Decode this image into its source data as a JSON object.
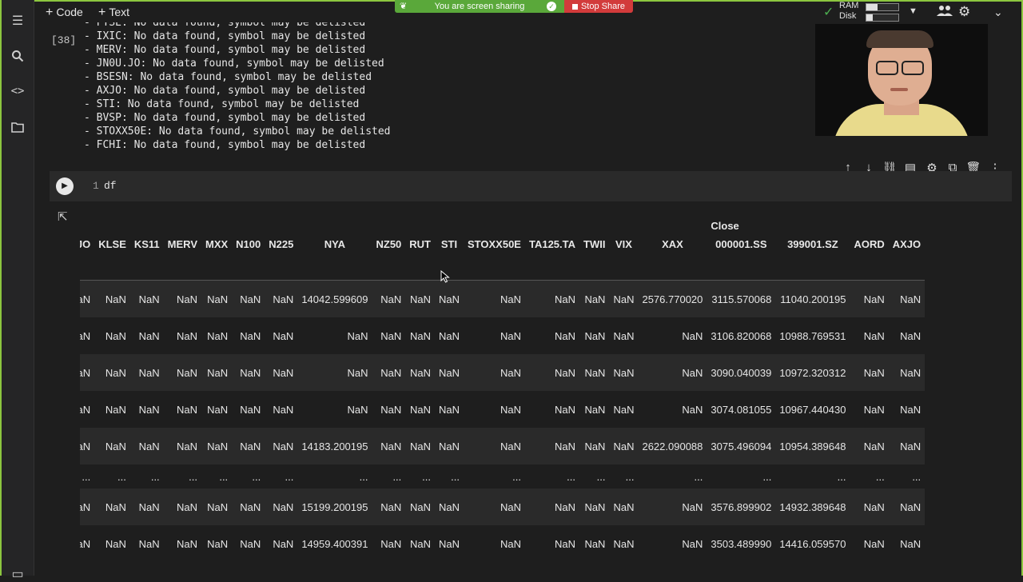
{
  "toolbar": {
    "code_label": "Code",
    "text_label": "Text"
  },
  "share": {
    "message": "You are screen sharing",
    "stop_label": "Stop Share"
  },
  "runtime": {
    "ram_label": "RAM",
    "disk_label": "Disk",
    "ram_usage": 0.35,
    "disk_usage": 0.2
  },
  "output": {
    "execution_count": "[38]",
    "lines": [
      "- FTSE: No data found, symbol may be delisted",
      "- IXIC: No data found, symbol may be delisted",
      "- MERV: No data found, symbol may be delisted",
      "- JN0U.JO: No data found, symbol may be delisted",
      "- BSESN: No data found, symbol may be delisted",
      "- AXJO: No data found, symbol may be delisted",
      "- STI: No data found, symbol may be delisted",
      "- BVSP: No data found, symbol may be delisted",
      "- STOXX50E: No data found, symbol may be delisted",
      "- FCHI: No data found, symbol may be delisted"
    ]
  },
  "cell": {
    "line_number": "1",
    "code": "df"
  },
  "dataframe": {
    "group_header": "Close",
    "columns": [
      "J.JO",
      "KLSE",
      "KS11",
      "MERV",
      "MXX",
      "N100",
      "N225",
      "NYA",
      "NZ50",
      "RUT",
      "STI",
      "STOXX50E",
      "TA125.TA",
      "TWII",
      "VIX",
      "XAX",
      "000001.SS",
      "399001.SZ",
      "AORD",
      "AXJO"
    ],
    "rows": [
      [
        "NaN",
        "NaN",
        "NaN",
        "NaN",
        "NaN",
        "NaN",
        "NaN",
        "14042.599609",
        "NaN",
        "NaN",
        "NaN",
        "NaN",
        "NaN",
        "NaN",
        "NaN",
        "2576.770020",
        "3115.570068",
        "11040.200195",
        "NaN",
        "NaN"
      ],
      [
        "NaN",
        "NaN",
        "NaN",
        "NaN",
        "NaN",
        "NaN",
        "NaN",
        "NaN",
        "NaN",
        "NaN",
        "NaN",
        "NaN",
        "NaN",
        "NaN",
        "NaN",
        "NaN",
        "3106.820068",
        "10988.769531",
        "NaN",
        "NaN"
      ],
      [
        "NaN",
        "NaN",
        "NaN",
        "NaN",
        "NaN",
        "NaN",
        "NaN",
        "NaN",
        "NaN",
        "NaN",
        "NaN",
        "NaN",
        "NaN",
        "NaN",
        "NaN",
        "NaN",
        "3090.040039",
        "10972.320312",
        "NaN",
        "NaN"
      ],
      [
        "NaN",
        "NaN",
        "NaN",
        "NaN",
        "NaN",
        "NaN",
        "NaN",
        "NaN",
        "NaN",
        "NaN",
        "NaN",
        "NaN",
        "NaN",
        "NaN",
        "NaN",
        "NaN",
        "3074.081055",
        "10967.440430",
        "NaN",
        "NaN"
      ],
      [
        "NaN",
        "NaN",
        "NaN",
        "NaN",
        "NaN",
        "NaN",
        "NaN",
        "14183.200195",
        "NaN",
        "NaN",
        "NaN",
        "NaN",
        "NaN",
        "NaN",
        "NaN",
        "2622.090088",
        "3075.496094",
        "10954.389648",
        "NaN",
        "NaN"
      ],
      [
        "...",
        "...",
        "...",
        "...",
        "...",
        "...",
        "...",
        "...",
        "...",
        "...",
        "...",
        "...",
        "...",
        "...",
        "...",
        "...",
        "...",
        "...",
        "...",
        "..."
      ],
      [
        "NaN",
        "NaN",
        "NaN",
        "NaN",
        "NaN",
        "NaN",
        "NaN",
        "15199.200195",
        "NaN",
        "NaN",
        "NaN",
        "NaN",
        "NaN",
        "NaN",
        "NaN",
        "NaN",
        "3576.899902",
        "14932.389648",
        "NaN",
        "NaN"
      ],
      [
        "NaN",
        "NaN",
        "NaN",
        "NaN",
        "NaN",
        "NaN",
        "NaN",
        "14959.400391",
        "NaN",
        "NaN",
        "NaN",
        "NaN",
        "NaN",
        "NaN",
        "NaN",
        "NaN",
        "3503.489990",
        "14416.059570",
        "NaN",
        "NaN"
      ]
    ]
  }
}
